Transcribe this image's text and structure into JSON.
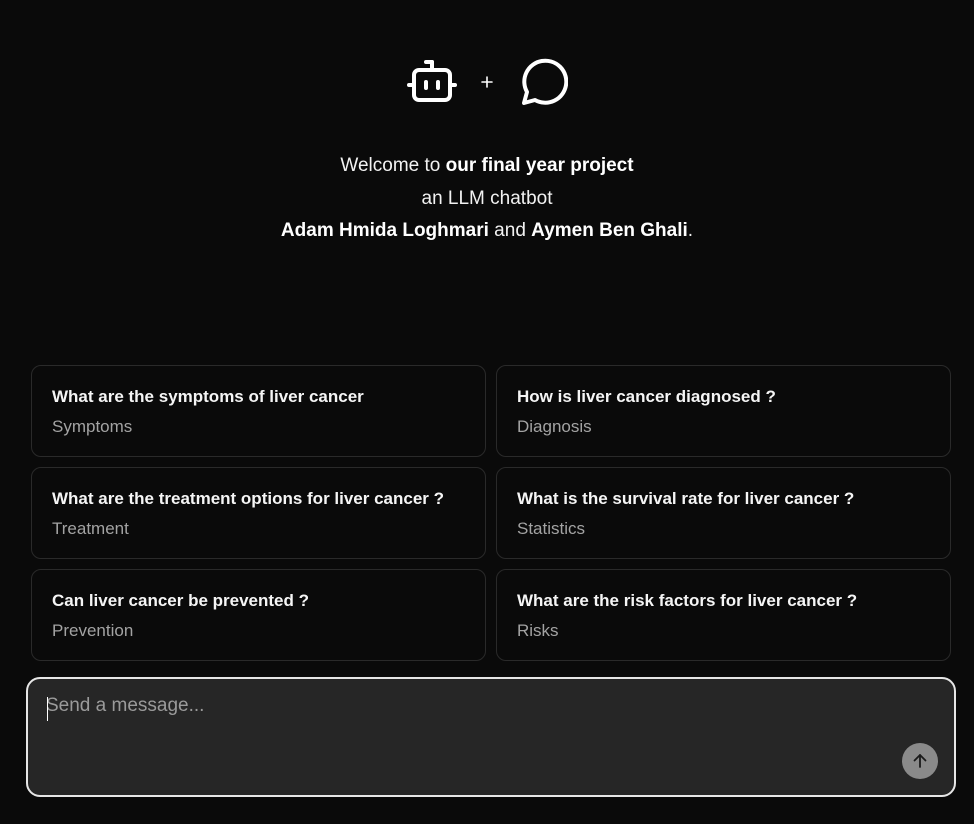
{
  "header": {
    "left_icon": "bot-icon",
    "separator": "+",
    "right_icon": "message-circle-icon"
  },
  "welcome": {
    "line1_prefix": "Welcome to ",
    "line1_bold": "our final year project",
    "line2": "an LLM chatbot",
    "author1": "Adam Hmida Loghmari",
    "and": " and ",
    "author2": "Aymen Ben Ghali",
    "end": "."
  },
  "suggestions": [
    {
      "question": "What are the symptoms of liver cancer",
      "category": "Symptoms"
    },
    {
      "question": "How is liver cancer diagnosed ?",
      "category": "Diagnosis"
    },
    {
      "question": "What are the treatment options for liver cancer ?",
      "category": "Treatment"
    },
    {
      "question": "What is the survival rate for liver cancer ?",
      "category": "Statistics"
    },
    {
      "question": "Can liver cancer be prevented ?",
      "category": "Prevention"
    },
    {
      "question": "What are the risk factors for liver cancer ?",
      "category": "Risks"
    }
  ],
  "composer": {
    "placeholder": "Send a message...",
    "value": "",
    "send_icon": "arrow-up-icon"
  },
  "colors": {
    "background": "#0a0a0a",
    "card_border": "#2a2a2a",
    "composer_bg": "#262626",
    "send_button": "#8a8a8a"
  }
}
